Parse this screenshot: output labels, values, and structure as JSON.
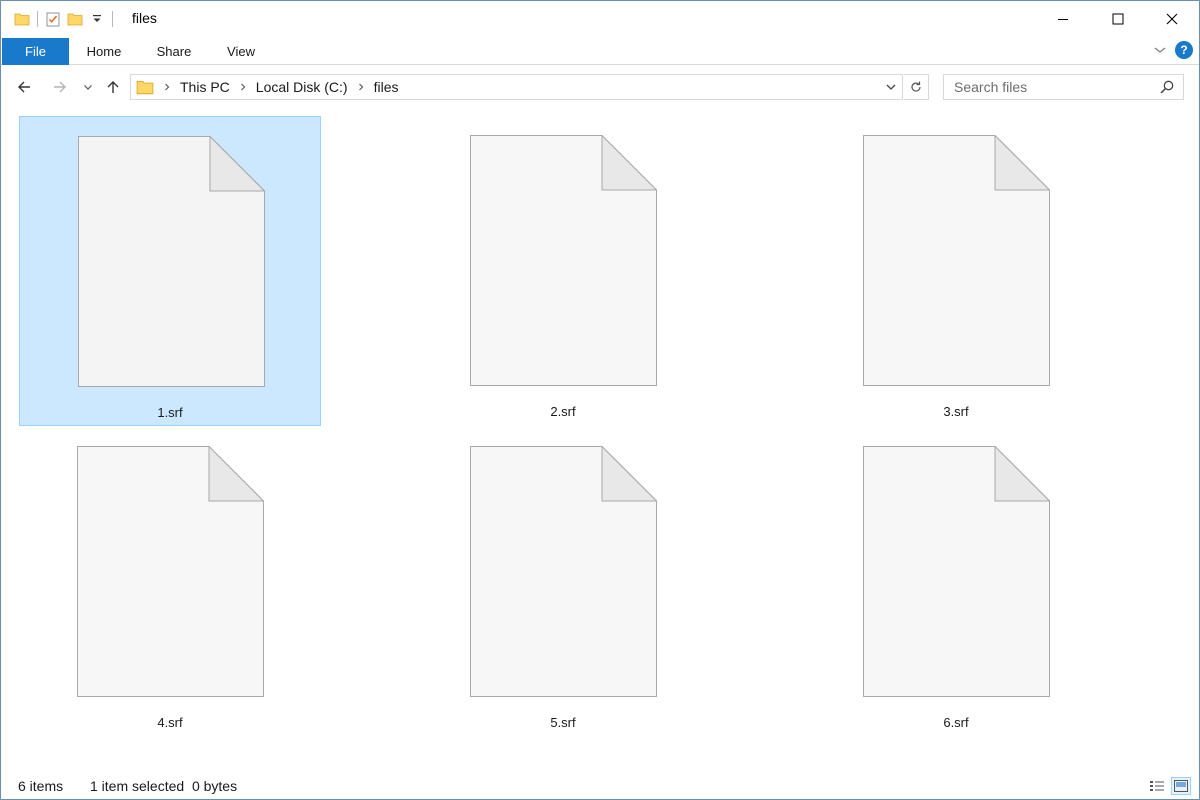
{
  "window": {
    "title": "files",
    "controls": {
      "minimize": "minimize-icon",
      "maximize": "maximize-icon",
      "close": "close-icon"
    }
  },
  "quick_access": [
    "folder-icon",
    "properties-checkmark-icon",
    "new-folder-icon",
    "customize-dropdown-icon"
  ],
  "ribbon": {
    "tabs": [
      {
        "label": "File",
        "active": true
      },
      {
        "label": "Home"
      },
      {
        "label": "Share"
      },
      {
        "label": "View"
      }
    ],
    "expand_icon": "chevron-down-icon",
    "help_label": "?"
  },
  "nav": {
    "back_icon": "back-arrow-icon",
    "forward_icon": "forward-arrow-icon",
    "recent_icon": "chevron-down-icon",
    "up_icon": "up-arrow-icon",
    "breadcrumb": [
      "This PC",
      "Local Disk (C:)",
      "files"
    ],
    "refresh_icon": "refresh-icon"
  },
  "search": {
    "placeholder": "Search files",
    "value": ""
  },
  "files": [
    {
      "name": "1.srf",
      "selected": true
    },
    {
      "name": "2.srf",
      "selected": false
    },
    {
      "name": "3.srf",
      "selected": false
    },
    {
      "name": "4.srf",
      "selected": false
    },
    {
      "name": "5.srf",
      "selected": false
    },
    {
      "name": "6.srf",
      "selected": false
    }
  ],
  "status": {
    "item_count": "6 items",
    "selection": "1 item selected  0 bytes"
  },
  "colors": {
    "accent": "#1979ca",
    "selection_bg": "#cce8ff",
    "selection_border": "#99d1ff",
    "folder": "#ffd767"
  }
}
